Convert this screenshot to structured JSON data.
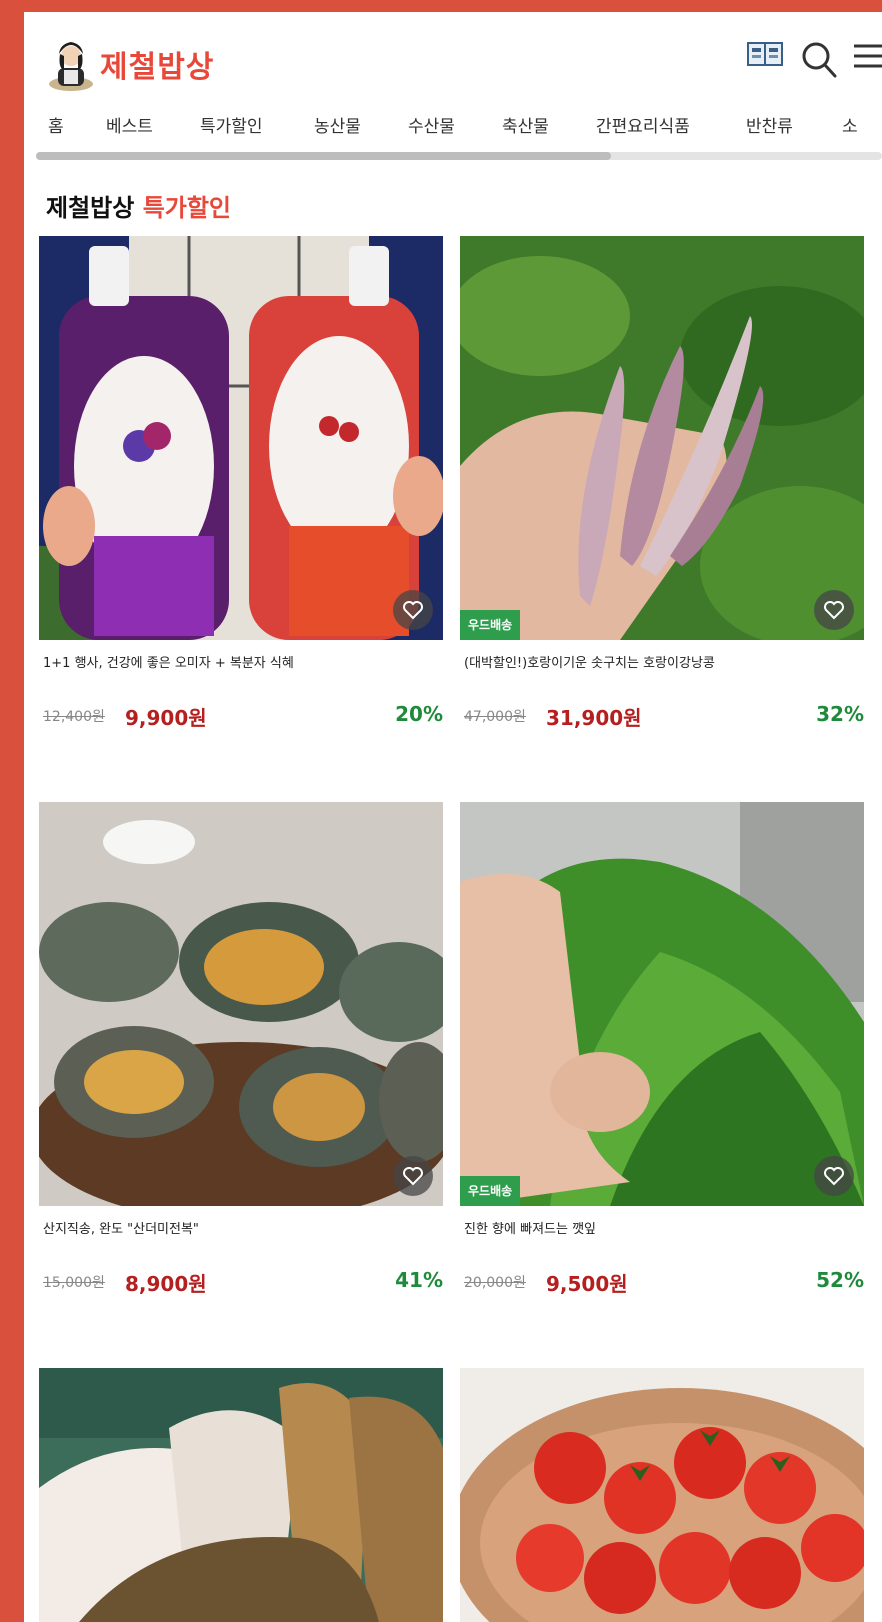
{
  "header": {
    "brand": "제철밥상",
    "icons": [
      "book-icon",
      "search-icon",
      "menu-icon"
    ]
  },
  "nav": {
    "tabs": [
      "홈",
      "베스트",
      "특가할인",
      "농산물",
      "수산물",
      "축산물",
      "간편요리식품",
      "반찬류",
      "소"
    ],
    "scroll_position_fraction": 0.68
  },
  "section": {
    "title_prefix": "제철밥상",
    "title_accent": "특가할인"
  },
  "products": [
    {
      "name": "1+1 행사, 건강에 좋은 오미자 + 복분자 식혜",
      "original_price": "12,400원",
      "price": "9,900원",
      "discount": "20%",
      "tag": ""
    },
    {
      "name": "(대박할인!)호랑이기운 솟구치는 호랑이강낭콩",
      "original_price": "47,000원",
      "price": "31,900원",
      "discount": "32%",
      "tag": "우드배송"
    },
    {
      "name": "산지직송, 완도 \"산더미전복\"",
      "original_price": "15,000원",
      "price": "8,900원",
      "discount": "41%",
      "tag": ""
    },
    {
      "name": "진한 향에 빠져드는 깻잎",
      "original_price": "20,000원",
      "price": "9,500원",
      "discount": "52%",
      "tag": "우드배송"
    },
    {
      "name": "",
      "original_price": "",
      "price": "",
      "discount": "",
      "tag": ""
    },
    {
      "name": "",
      "original_price": "",
      "price": "",
      "discount": "",
      "tag": ""
    }
  ],
  "colors": {
    "brand_red": "#e8483a",
    "price_red": "#b51f1f",
    "discount_green": "#1f8a3b",
    "tag_green": "#2e9e4d",
    "outer_bg": "#d9503c"
  }
}
